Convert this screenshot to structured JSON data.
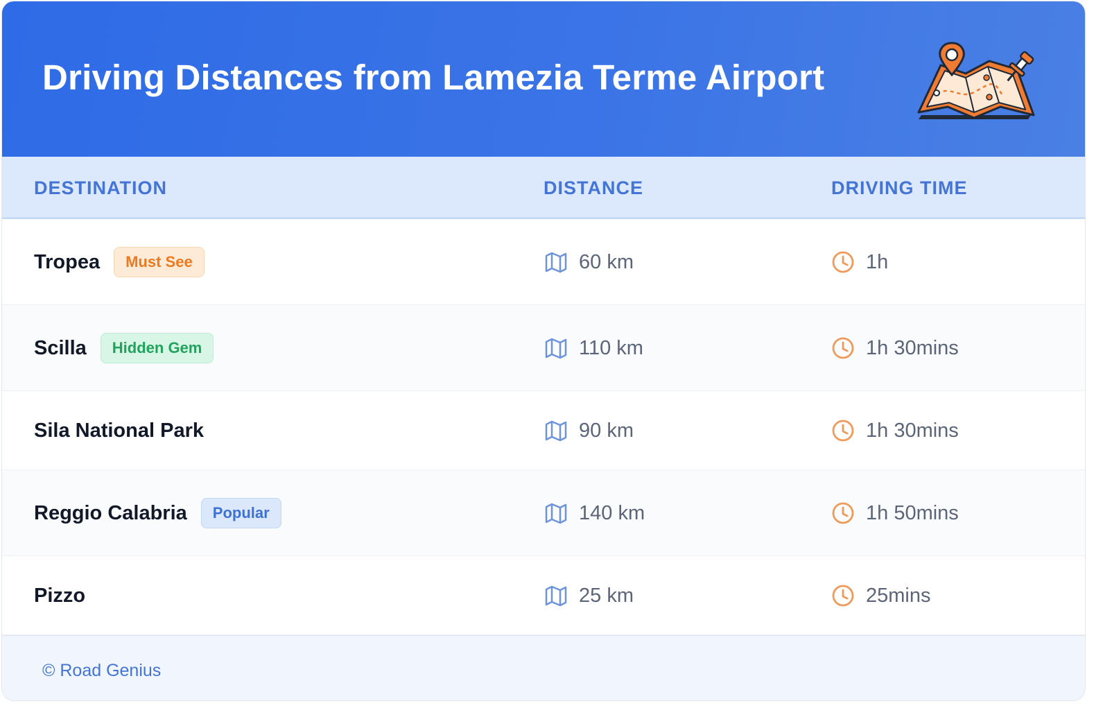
{
  "header": {
    "title": "Driving Distances from Lamezia Terme Airport",
    "illustration_icon": "map-with-pins-icon"
  },
  "table": {
    "columns": [
      "DESTINATION",
      "DISTANCE",
      "DRIVING TIME"
    ],
    "distance_icon": "map-icon",
    "time_icon": "clock-icon",
    "rows": [
      {
        "destination": "Tropea",
        "badge": "Must See",
        "badge_color": "#ee7a1e",
        "distance": "60 km",
        "time": "1h"
      },
      {
        "destination": "Scilla",
        "badge": "Hidden Gem",
        "badge_color": "#21a35d",
        "distance": "110 km",
        "time": "1h 30mins"
      },
      {
        "destination": "Sila National Park",
        "badge": "",
        "badge_color": "",
        "distance": "90 km",
        "time": "1h 30mins"
      },
      {
        "destination": "Reggio Calabria",
        "badge": "Popular",
        "badge_color": "#3d72d4",
        "distance": "140 km",
        "time": "1h 50mins"
      },
      {
        "destination": "Pizzo",
        "badge": "",
        "badge_color": "",
        "distance": "25 km",
        "time": "25mins"
      }
    ]
  },
  "footer": {
    "text": "© Road Genius"
  },
  "colors": {
    "header_bg": "#2e6be6",
    "accent_blue": "#4475d6",
    "clock_orange": "#f09a5a"
  }
}
